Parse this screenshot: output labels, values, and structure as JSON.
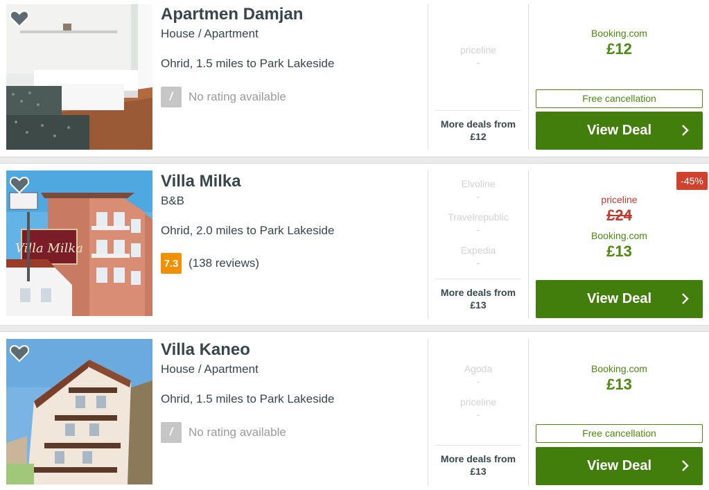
{
  "listings": [
    {
      "name": "Apartmen Damjan",
      "type": "House / Apartment",
      "location": "Ohrid, 1.5 miles to Park Lakeside",
      "rating_badge": "/",
      "rating_text": "No rating available",
      "other_deals": [
        {
          "provider": "priceline",
          "price": "-"
        }
      ],
      "more_deals": "More deals from",
      "more_deals_price": "£12",
      "best_provider": "Booking.com",
      "best_price": "£12",
      "free_cancellation": "Free cancellation",
      "cta": "View Deal"
    },
    {
      "name": "Villa Milka",
      "type": "B&B",
      "location": "Ohrid, 2.0 miles to Park Lakeside",
      "rating_badge": "7.3",
      "rating_text": "(138 reviews)",
      "other_deals": [
        {
          "provider": "Elvoline",
          "price": "-"
        },
        {
          "provider": "Travelrepublic",
          "price": "-"
        },
        {
          "provider": "Expedia",
          "price": "-"
        }
      ],
      "more_deals": "More deals from",
      "more_deals_price": "£13",
      "discount": "-45%",
      "strike_provider": "priceline",
      "strike_price": "£24",
      "best_provider": "Booking.com",
      "best_price": "£13",
      "cta": "View Deal"
    },
    {
      "name": "Villa Kaneo",
      "type": "House / Apartment",
      "location": "Ohrid, 1.5 miles to Park Lakeside",
      "rating_badge": "/",
      "rating_text": "No rating available",
      "other_deals": [
        {
          "provider": "Agoda",
          "price": "-"
        },
        {
          "provider": "priceline",
          "price": "-"
        }
      ],
      "more_deals": "More deals from",
      "more_deals_price": "£13",
      "best_provider": "Booking.com",
      "best_price": "£13",
      "free_cancellation": "Free cancellation",
      "cta": "View Deal"
    }
  ],
  "photo_sign_text": "Villa Milka",
  "colors": {
    "accent_green": "#427e0b",
    "price_green": "#4a8a0c",
    "rating_orange": "#f48f00",
    "discount_red": "#d0412e"
  },
  "icons": [
    "heart-icon",
    "chevron-right-icon"
  ]
}
